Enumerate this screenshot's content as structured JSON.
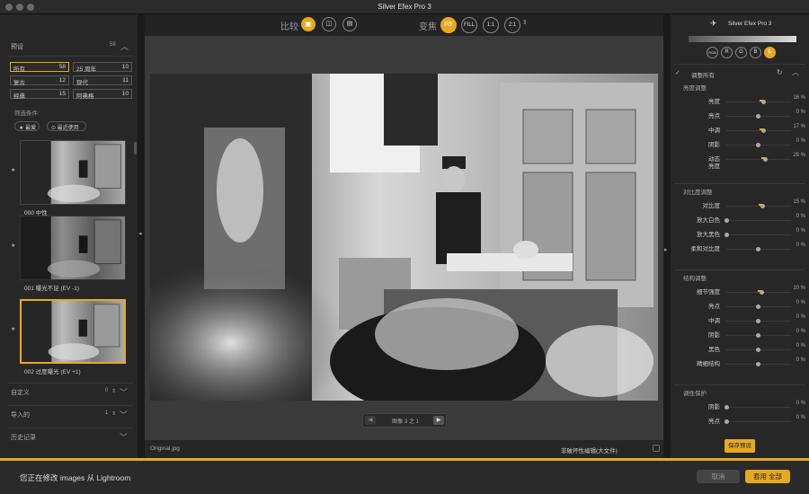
{
  "app": {
    "title": "Silver Efex Pro 3"
  },
  "left_panel": {
    "presets_header": "预设",
    "presets_count": "58",
    "preset_categories": [
      {
        "name": "所有",
        "count": "58",
        "selected": true
      },
      {
        "name": "25 周年",
        "count": "10"
      },
      {
        "name": "复古",
        "count": "12"
      },
      {
        "name": "现代",
        "count": "11"
      },
      {
        "name": "经典",
        "count": "15"
      },
      {
        "name": " 阿弗格",
        "count": "10"
      }
    ],
    "filter_label": "筛选条件:",
    "filter_fav": "最爱",
    "filter_recent": "最近使用",
    "thumbs": [
      {
        "label": "000 中性"
      },
      {
        "label": "001 曝光不足 (EV -1)"
      },
      {
        "label": "002 过度曝光 (EV +1)",
        "selected": true
      }
    ],
    "sections": [
      {
        "label": "自定义",
        "count": "0"
      },
      {
        "label": "导入的",
        "count": "1"
      },
      {
        "label": "历史记录",
        "count": ""
      }
    ]
  },
  "toolbar": {
    "compare_label": "比较",
    "zoom_label": "变焦",
    "zoom_options": [
      "FIT",
      "FILL",
      "1:1",
      "2:1"
    ]
  },
  "canvas": {
    "pager_text": "图像 3 之 1",
    "filename": "Original.jpg",
    "nondestructive": "非破坏性编辑(大文件)"
  },
  "right_panel": {
    "brand": "Silver Efex Pro 3",
    "channels": [
      "RGB",
      "R",
      "G",
      "B",
      "L"
    ],
    "adjust_all": "调整所有",
    "groups": [
      {
        "title": "亮度调整",
        "sliders": [
          {
            "name": "亮度",
            "value": "16 %",
            "pct": 0.58,
            "mark": true
          },
          {
            "name": "亮点",
            "value": "0 %",
            "pct": 0.5
          },
          {
            "name": "中调",
            "value": "17 %",
            "pct": 0.58,
            "mark": true
          },
          {
            "name": "阴影",
            "value": "0 %",
            "pct": 0.5
          },
          {
            "name": "动态\n亮度",
            "value": "25 %",
            "pct": 0.62,
            "mark": true
          }
        ]
      },
      {
        "title": "对比度调整",
        "sliders": [
          {
            "name": "对比度",
            "value": "15 %",
            "pct": 0.57,
            "mark": true
          },
          {
            "name": "放大白色",
            "value": "0 %",
            "pct": 0.0
          },
          {
            "name": "放大黑色",
            "value": "0 %",
            "pct": 0.0
          },
          {
            "name": "柔和对比度",
            "value": "0 %",
            "pct": 0.5
          }
        ]
      },
      {
        "title": "结构调整",
        "sliders": [
          {
            "name": "细节强度",
            "value": "10 %",
            "pct": 0.55,
            "mark": true
          },
          {
            "name": "亮点",
            "value": "0 %",
            "pct": 0.5
          },
          {
            "name": "中调",
            "value": "0 %",
            "pct": 0.5
          },
          {
            "name": "阴影",
            "value": "0 %",
            "pct": 0.5
          },
          {
            "name": "黑色",
            "value": "0 %",
            "pct": 0.5
          },
          {
            "name": "精细结构",
            "value": "0 %",
            "pct": 0.5
          }
        ]
      },
      {
        "title": "调性保护",
        "sliders": [
          {
            "name": "阴影",
            "value": "0 %",
            "pct": 0.0
          },
          {
            "name": "亮点",
            "value": "0 %",
            "pct": 0.0
          }
        ]
      }
    ],
    "save_preset": "保存预设"
  },
  "footer": {
    "status": "您正在修改 images 从 Lightroom",
    "cancel": "取消",
    "apply": "套用 全部"
  },
  "colors": {
    "accent": "#e8a91c"
  }
}
